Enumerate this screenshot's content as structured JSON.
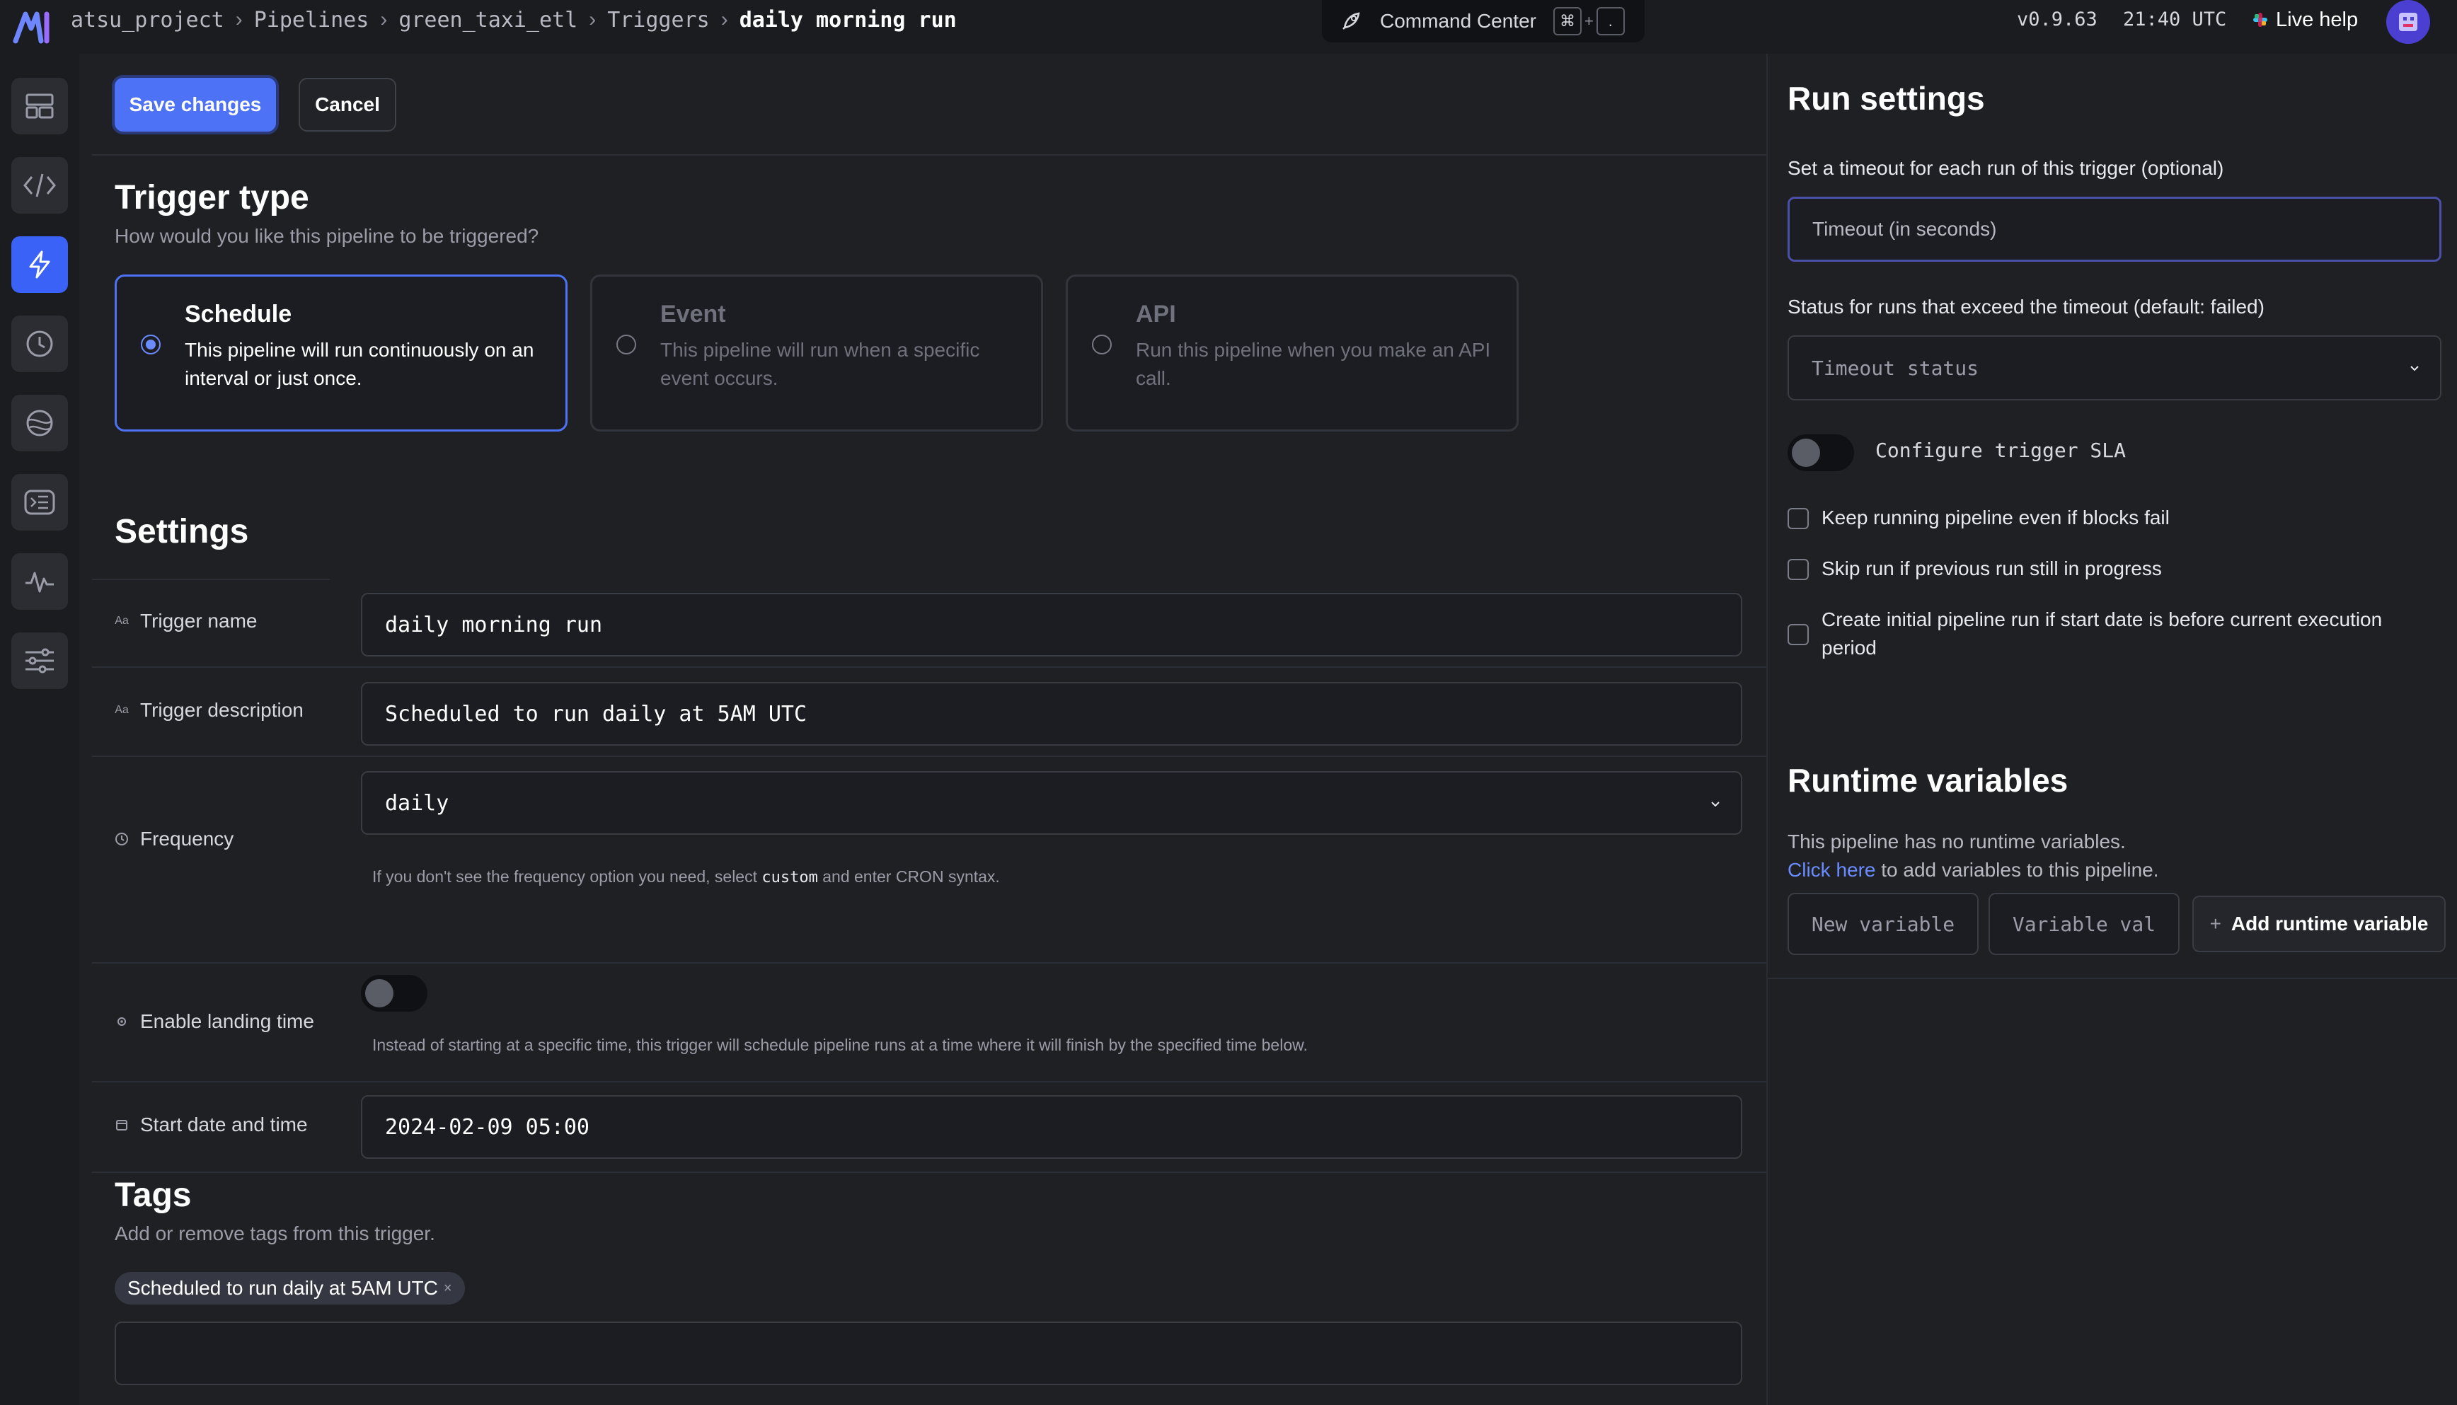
{
  "topbar": {
    "breadcrumb": [
      "atsu_project",
      "Pipelines",
      "green_taxi_etl",
      "Triggers",
      "daily morning run"
    ],
    "command_center": "Command Center",
    "shortcut_key_1": "⌘",
    "shortcut_plus": "+",
    "shortcut_key_2": ".",
    "version": "v0.9.63",
    "time": "21:40 UTC",
    "live_help": "Live help"
  },
  "leftnav": {
    "items": [
      "dashboard-icon",
      "code-icon",
      "trigger-bolt-icon",
      "clock-icon",
      "data-globe-icon",
      "terminal-icon",
      "activity-icon",
      "settings-sliders-icon"
    ],
    "active": "trigger-bolt-icon",
    "accent": "#3b62f6"
  },
  "actions": {
    "save": "Save changes",
    "cancel": "Cancel"
  },
  "trigger_type": {
    "title": "Trigger type",
    "subtitle": "How would you like this pipeline to be triggered?",
    "options": [
      {
        "title": "Schedule",
        "description": "This pipeline will run continuously on an interval or just once.",
        "selected": true
      },
      {
        "title": "Event",
        "description": "This pipeline will run when a specific event occurs.",
        "selected": false
      },
      {
        "title": "API",
        "description": "Run this pipeline when you make an API call.",
        "selected": false
      }
    ]
  },
  "settings": {
    "title": "Settings",
    "trigger_name": {
      "label": "Trigger name",
      "icon": "Aa",
      "value": "daily morning run"
    },
    "trigger_description": {
      "label": "Trigger description",
      "icon": "Aa",
      "value": "Scheduled to run daily at 5AM UTC"
    },
    "frequency": {
      "label": "Frequency",
      "value": "daily",
      "hint_before": "If you don't see the frequency option you need, select",
      "hint_code": "custom",
      "hint_after": "and enter CRON syntax."
    },
    "landing_time": {
      "label": "Enable landing time",
      "enabled": false,
      "hint": "Instead of starting at a specific time, this trigger will schedule pipeline runs at a time where it will finish by the specified time below."
    },
    "start_date": {
      "label": "Start date and time",
      "value": "2024-02-09 05:00"
    }
  },
  "tags": {
    "title": "Tags",
    "subtitle": "Add or remove tags from this trigger.",
    "items": [
      "Scheduled to run daily at 5AM UTC"
    ],
    "remove_glyph": "×"
  },
  "run_settings": {
    "title": "Run settings",
    "timeout_label": "Set a timeout for each run of this trigger (optional)",
    "timeout_placeholder": "Timeout (in seconds)",
    "timeout_status_label": "Status for runs that exceed the timeout (default: failed)",
    "timeout_status_placeholder": "Timeout status",
    "sla_label": "Configure trigger SLA",
    "sla_enabled": false,
    "checkboxes": [
      {
        "label": "Keep running pipeline even if blocks fail",
        "checked": false
      },
      {
        "label": "Skip run if previous run still in progress",
        "checked": false
      },
      {
        "label": "Create initial pipeline run if start date is before current execution period",
        "checked": false
      }
    ]
  },
  "runtime_variables": {
    "title": "Runtime variables",
    "empty_text": "This pipeline has no runtime variables.",
    "link_text": "Click here",
    "link_suffix": " to add variables to this pipeline.",
    "new_variable_placeholder": "New variable",
    "variable_value_placeholder": "Variable val",
    "add_button": "Add runtime variable",
    "link_color": "#6b8cff"
  }
}
